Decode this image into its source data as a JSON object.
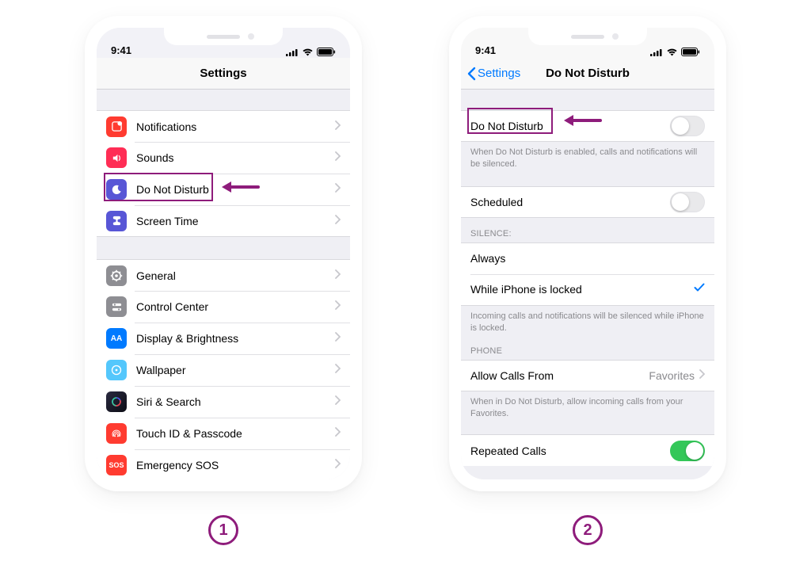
{
  "status": {
    "time": "9:41"
  },
  "phone1": {
    "title": "Settings",
    "items_g1": [
      {
        "label": "Notifications",
        "icon": "notifications-icon",
        "bg": "#ff3b30"
      },
      {
        "label": "Sounds",
        "icon": "sounds-icon",
        "bg": "#ff2d55"
      },
      {
        "label": "Do Not Disturb",
        "icon": "dnd-icon",
        "bg": "#5856d6"
      },
      {
        "label": "Screen Time",
        "icon": "screentime-icon",
        "bg": "#5856d6"
      }
    ],
    "items_g2": [
      {
        "label": "General",
        "icon": "general-icon",
        "bg": "#8e8e93"
      },
      {
        "label": "Control Center",
        "icon": "controlcenter-icon",
        "bg": "#8e8e93"
      },
      {
        "label": "Display & Brightness",
        "icon": "display-icon",
        "bg": "#007aff"
      },
      {
        "label": "Wallpaper",
        "icon": "wallpaper-icon",
        "bg": "#54c7fc"
      },
      {
        "label": "Siri & Search",
        "icon": "siri-icon",
        "bg": "#1c1c1e"
      },
      {
        "label": "Touch ID & Passcode",
        "icon": "touchid-icon",
        "bg": "#ff3b30"
      },
      {
        "label": "Emergency SOS",
        "icon": "sos-icon",
        "bg": "#ff3b30",
        "text": "SOS"
      }
    ]
  },
  "phone2": {
    "back": "Settings",
    "title": "Do Not Disturb",
    "dnd_label": "Do Not Disturb",
    "dnd_footer": "When Do Not Disturb is enabled, calls and notifications will be silenced.",
    "scheduled_label": "Scheduled",
    "silence_header": "SILENCE:",
    "silence_always": "Always",
    "silence_locked": "While iPhone is locked",
    "silence_footer": "Incoming calls and notifications will be silenced while iPhone is locked.",
    "phone_header": "PHONE",
    "allow_label": "Allow Calls From",
    "allow_value": "Favorites",
    "allow_footer": "When in Do Not Disturb, allow incoming calls from your Favorites.",
    "repeated_label": "Repeated Calls"
  },
  "steps": {
    "one": "1",
    "two": "2"
  }
}
